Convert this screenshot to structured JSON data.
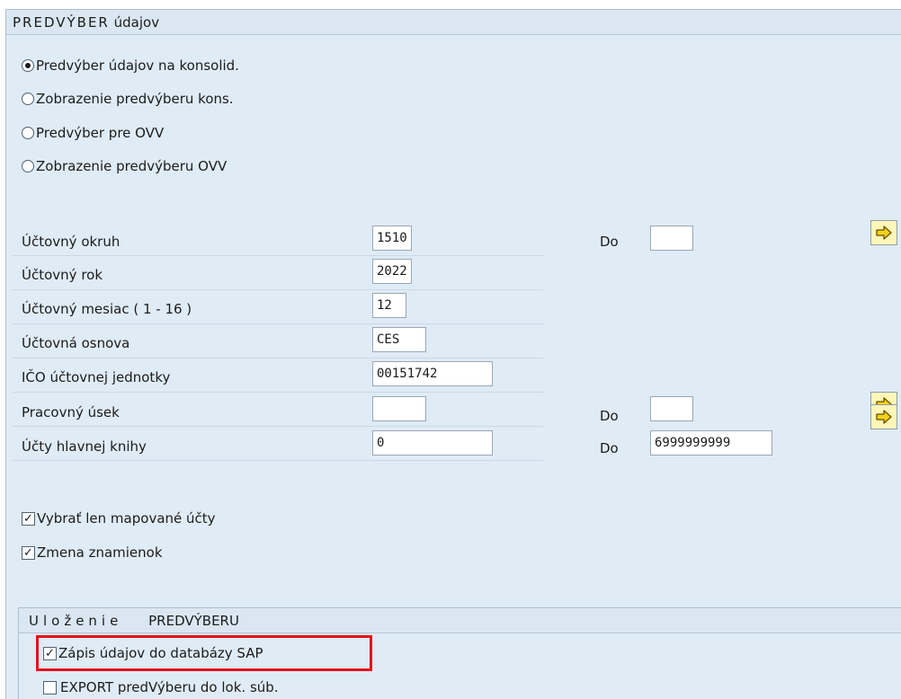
{
  "frame": {
    "title_spaced": "PREDVÝBER",
    "title_rest": "údajov"
  },
  "radios": [
    {
      "label": "Predvýber údajov na konsolid.",
      "selected": true
    },
    {
      "label": "Zobrazenie predvýberu kons.",
      "selected": false
    },
    {
      "label": "Predvýber pre OVV",
      "selected": false
    },
    {
      "label": "Zobrazenie predvýberu OVV",
      "selected": false
    }
  ],
  "fields": {
    "company_code": {
      "label": "Účtovný okruh",
      "value": "1510",
      "to_label": "Do",
      "to_value": ""
    },
    "fiscal_year": {
      "label": "Účtovný rok",
      "value": "2022"
    },
    "period": {
      "label": "Účtovný mesiac ( 1 - 16 )",
      "value": "12"
    },
    "chart_of_accounts": {
      "label": "Účtovná osnova",
      "value": "CES"
    },
    "ico": {
      "label": "IČO účtovnej jednotky",
      "value": "00151742"
    },
    "work_section": {
      "label": "Pracovný úsek",
      "value": "",
      "to_label": "Do",
      "to_value": ""
    },
    "gl_accounts": {
      "label": "Účty hlavnej knihy",
      "value": "0",
      "to_label": "Do",
      "to_value": "6999999999"
    }
  },
  "checks": [
    {
      "label": "Vybrať len mapované účty",
      "checked": true
    },
    {
      "label": "Zmena znamienok",
      "checked": true
    }
  ],
  "save_group": {
    "title_spaced": "Uloženie",
    "title_rest": "PREDVÝBERU",
    "checks": [
      {
        "label": "Zápis údajov do databázy SAP",
        "checked": true
      },
      {
        "label": "EXPORT predVýberu do lok. súb.",
        "checked": false
      }
    ]
  },
  "icons": {
    "multiple_selection": "arrow-right-icon"
  },
  "colors": {
    "background": "#dfebf5",
    "header": "#dae7f2",
    "button": "#fff6b8",
    "highlight": "#e2141c"
  }
}
